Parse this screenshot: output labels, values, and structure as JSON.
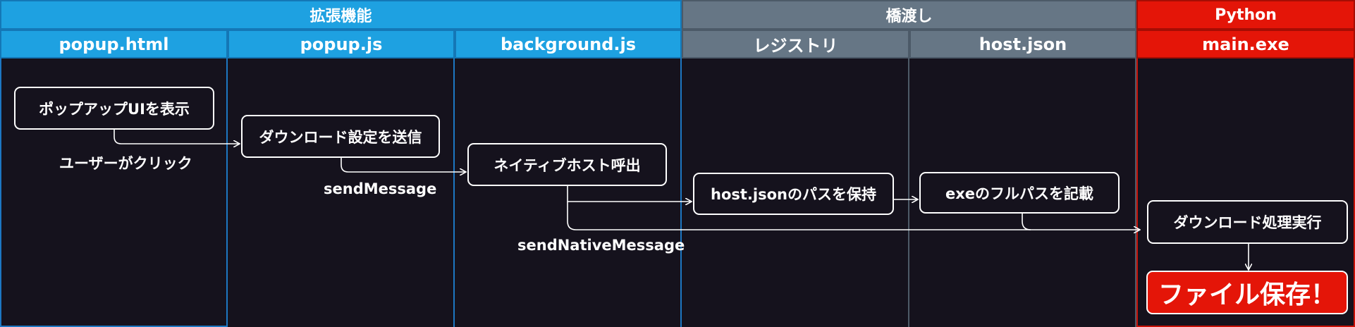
{
  "groups": {
    "extension": "拡張機能",
    "bridge": "橋渡し",
    "python": "Python"
  },
  "lanes": {
    "popup_html": "popup.html",
    "popup_js": "popup.js",
    "background_js": "background.js",
    "registry": "レジストリ",
    "host_json": "host.json",
    "main_exe": "main.exe"
  },
  "nodes": {
    "show_popup": "ポップアップUIを表示",
    "send_settings": "ダウンロード設定を送信",
    "call_native_host": "ネイティブホスト呼出",
    "hold_host_path": "host.jsonのパスを保持",
    "write_exe_path": "exeのフルパスを記載",
    "run_download": "ダウンロード処理実行",
    "file_saved": "ファイル保存！"
  },
  "edge_labels": {
    "user_click": "ユーザーがクリック",
    "send_message": "sendMessage",
    "send_native_message": "sendNativeMessage"
  },
  "colors": {
    "background": "#15121d",
    "extension_header": "#1ea1e1",
    "bridge_header": "#667685",
    "python_header": "#e41508",
    "final_node": "#e41508"
  }
}
